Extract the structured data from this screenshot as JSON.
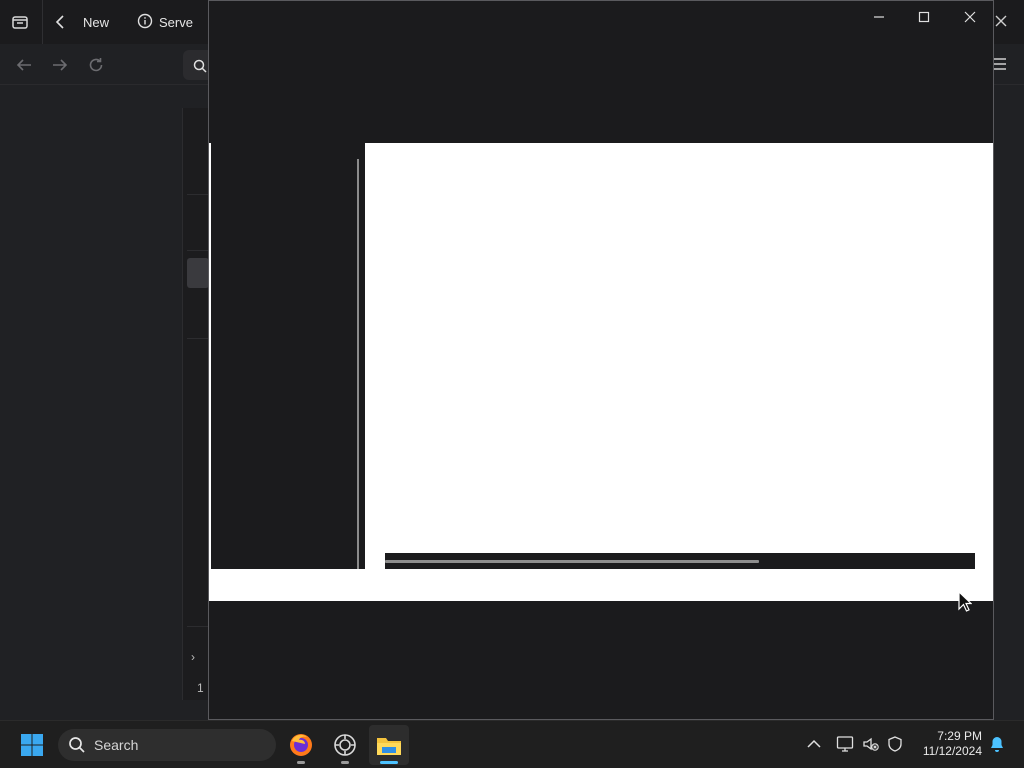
{
  "background_browser": {
    "tab_new_label": "New",
    "tab_server_label": "Serve",
    "status_count": "1"
  },
  "taskbar": {
    "search_placeholder": "Search",
    "apps": [
      {
        "name": "Firefox"
      },
      {
        "name": "Network app"
      },
      {
        "name": "File Explorer",
        "active": true
      }
    ],
    "clock": {
      "time": "7:29 PM",
      "date": "11/12/2024"
    }
  },
  "colors": {
    "accent": "#4cc2ff",
    "taskbar_bg": "#1f1f1f",
    "window_bg": "#1b1b1d",
    "content_bg": "#ffffff"
  }
}
